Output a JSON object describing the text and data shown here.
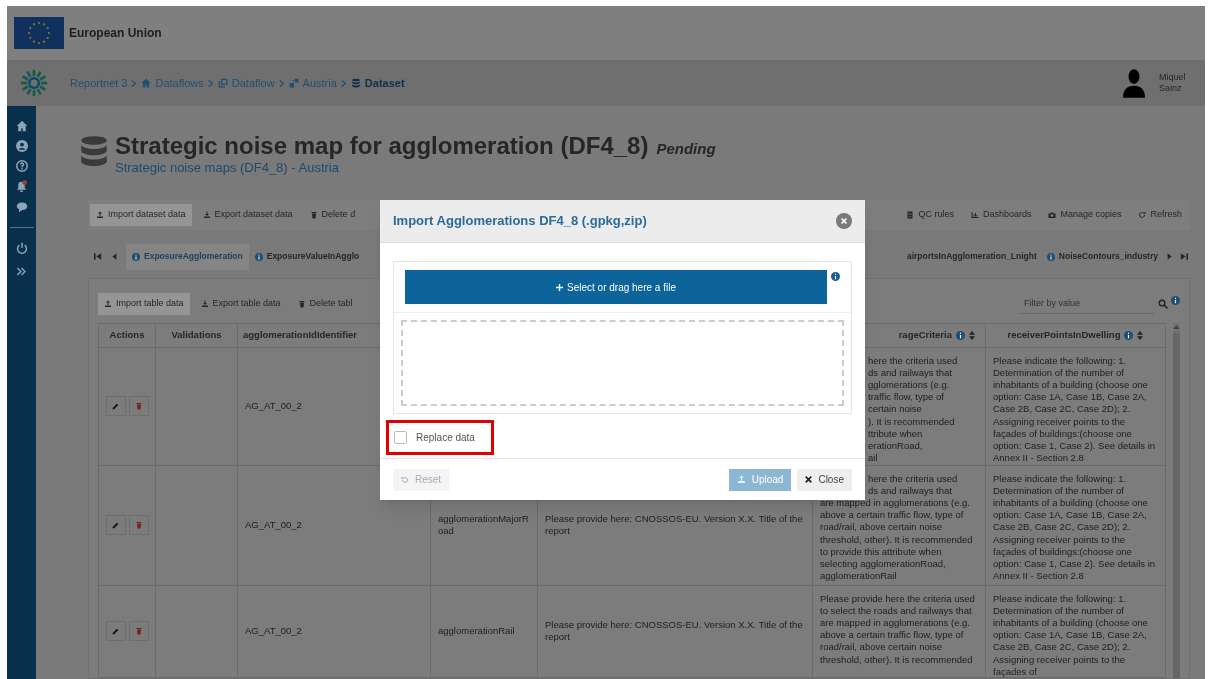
{
  "top_bar": {
    "title": "European Union"
  },
  "breadcrumb": [
    {
      "label": "Reportnet 3",
      "current": false
    },
    {
      "label": "Dataflows",
      "current": false
    },
    {
      "label": "Dataflow",
      "current": false
    },
    {
      "label": "Austria",
      "current": false
    },
    {
      "label": "Dataset",
      "current": true
    }
  ],
  "user": {
    "name": "Miquel Sainz"
  },
  "dataset": {
    "title": "Strategic noise map for agglomeration (DF4_8)",
    "status": "Pending",
    "subtitle": "Strategic noise maps (DF4_8) - Austria"
  },
  "toolbar": [
    {
      "label": "Import dataset data",
      "selected": true
    },
    {
      "label": "Export dataset data",
      "selected": false
    },
    {
      "label": "Delete d",
      "selected": false
    },
    {
      "label": "QC rules",
      "selected": false
    },
    {
      "label": "Dashboards",
      "selected": false
    },
    {
      "label": "Manage copies",
      "selected": false
    },
    {
      "label": "Refresh",
      "selected": false
    }
  ],
  "tabs": [
    {
      "label": "ExposureAgglomeration",
      "selected": true
    },
    {
      "label": "ExposureValueInAgglo",
      "selected": false
    },
    {
      "label": "airportsInAgglomeration_Lnight",
      "selected": false
    },
    {
      "label": "NoiseContours_industry",
      "selected": false
    }
  ],
  "table_toolbar": [
    {
      "label": "Import table data",
      "selected": true
    },
    {
      "label": "Export table data",
      "selected": false
    },
    {
      "label": "Delete tabl",
      "selected": false
    }
  ],
  "filter": {
    "placeholder": "Filter by value"
  },
  "table": {
    "columns": [
      {
        "label": "Actions",
        "info": false
      },
      {
        "label": "Validations",
        "info": false
      },
      {
        "label": "agglomerationIdIdentifier",
        "info": false
      },
      {},
      {},
      {
        "label": "rageCriteria",
        "info": true
      },
      {
        "label": "receiverPointsInDwelling",
        "info": true
      }
    ],
    "rows": [
      {
        "cells": [
          null,
          null,
          "AG_AT_00_2",
          null,
          null,
          {
            "clipped_lines": [
              "here the criteria used",
              "ds and railways that",
              "gglomerations (e.g.",
              "traffic flow, type of",
              "certain noise",
              "). It is recommended",
              "ttribute when",
              "erationRoad,",
              "ail"
            ]
          },
          "Please indicate the following: 1. Determination of the number of inhabitants of a building (choose one option: Case 1A, Case 1B, Case 2A, Case 2B, Case 2C, Case 2D); 2. Assigning receiver points to the façades of buildings:(choose one option: Case 1, Case 2). See details in Annex II - Section 2.8"
        ]
      },
      {
        "cells": [
          null,
          null,
          "AG_AT_00_2",
          "agglomerationMajorRoad",
          "Please provide here: CNOSSOS-EU. Version X.X. Title of the report",
          {
            "clipped_lines": [
              "here the criteria used",
              "ds and railways that"
            ],
            "text": "are mapped in agglomerations (e.g. above a certain traffic flow, type of road/rail, above certain noise threshold, other). It is recommended to provide this attribute when selecting agglomerationRoad, agglomerationRail"
          },
          "Please indicate the following: 1. Determination of the number of inhabitants of a building (choose one option: Case 1A, Case 1B, Case 2A, Case 2B, Case 2C, Case 2D); 2. Assigning receiver points to the façades of buildings:(choose one option: Case 1, Case 2). See details in Annex II - Section 2.8"
        ]
      },
      {
        "cells": [
          null,
          null,
          "AG_AT_00_2",
          "agglomerationRail",
          "Please provide here: CNOSSOS-EU. Version X.X. Title of the report",
          {
            "text": "Please provide here the criteria used to select the roads and railways that are mapped in agglomerations (e.g. above a certain traffic flow, type of road/rail, above certain noise threshold, other). It is recommended"
          },
          "Please indicate the following: 1. Determination of the number of inhabitants of a building (choose one option: Case 1A, Case 1B, Case 2A, Case 2B, Case 2C, Case 2D); 2. Assigning receiver points to the façades of"
        ]
      }
    ]
  },
  "dialog": {
    "title": "Import Agglomerations DF4_8 (.gpkg,zip)",
    "select_button": "Select or drag here a file",
    "replace_data": {
      "label": "Replace data",
      "checked": false
    },
    "buttons": [
      {
        "label": "Reset",
        "kind": "reset",
        "disabled": true
      },
      {
        "label": "Upload",
        "kind": "upload",
        "disabled": true
      },
      {
        "label": "Close",
        "kind": "close",
        "disabled": false
      }
    ]
  }
}
